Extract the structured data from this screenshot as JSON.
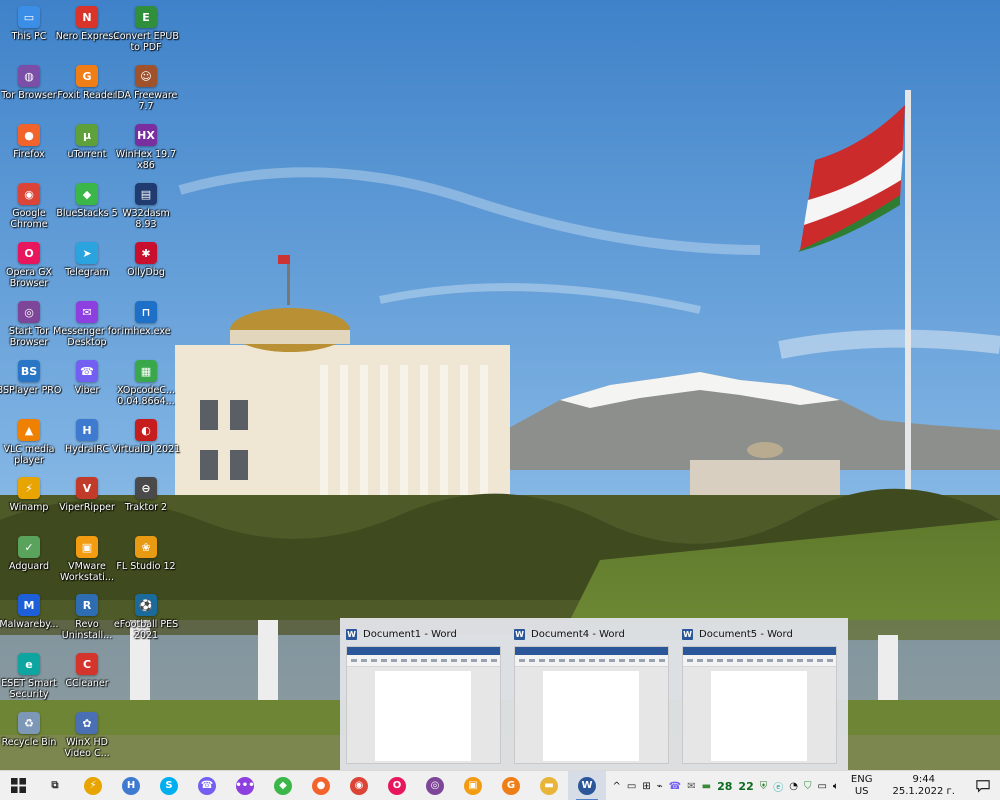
{
  "desktop": {
    "icons": [
      {
        "label": "This PC",
        "icon": "this-pc-icon",
        "color": "#3a8ee6",
        "glyph": "▭"
      },
      {
        "label": "Tor Browser",
        "icon": "tor-browser-icon",
        "color": "#7b4fa8",
        "glyph": "◍"
      },
      {
        "label": "Firefox",
        "icon": "firefox-icon",
        "color": "#f2642c",
        "glyph": "●"
      },
      {
        "label": "Google Chrome",
        "icon": "chrome-icon",
        "color": "#db4437",
        "glyph": "◉"
      },
      {
        "label": "Opera GX Browser",
        "icon": "opera-gx-icon",
        "color": "#e8175d",
        "glyph": "O"
      },
      {
        "label": "Start Tor Browser",
        "icon": "start-tor-icon",
        "color": "#7d4698",
        "glyph": "◎"
      },
      {
        "label": "BSPlayer PRO",
        "icon": "bsplayer-icon",
        "color": "#2a76c6",
        "glyph": "BS"
      },
      {
        "label": "VLC media player",
        "icon": "vlc-icon",
        "color": "#f08000",
        "glyph": "▲"
      },
      {
        "label": "Winamp",
        "icon": "winamp-icon",
        "color": "#e8a400",
        "glyph": "⚡"
      },
      {
        "label": "Adguard",
        "icon": "adguard-icon",
        "color": "#5aa35d",
        "glyph": "✓"
      },
      {
        "label": "Malwareby...",
        "icon": "malwarebytes-icon",
        "color": "#1d5fd8",
        "glyph": "M"
      },
      {
        "label": "ESET Smart Security",
        "icon": "eset-icon",
        "color": "#0ea5a0",
        "glyph": "e"
      },
      {
        "label": "Recycle Bin",
        "icon": "recycle-bin-icon",
        "color": "#7d98b6",
        "glyph": "♻"
      },
      {
        "label": "Nero Express",
        "icon": "nero-express-icon",
        "color": "#d8342a",
        "glyph": "N"
      },
      {
        "label": "Foxit Reader",
        "icon": "foxit-reader-icon",
        "color": "#f07e16",
        "glyph": "G"
      },
      {
        "label": "uTorrent",
        "icon": "utorrent-icon",
        "color": "#5ea03a",
        "glyph": "µ"
      },
      {
        "label": "BlueStacks 5",
        "icon": "bluestacks-icon",
        "color": "#3bb649",
        "glyph": "◆"
      },
      {
        "label": "Telegram",
        "icon": "telegram-icon",
        "color": "#2aa3de",
        "glyph": "➤"
      },
      {
        "label": "Messenger for Desktop",
        "icon": "messenger-icon",
        "color": "#8d3fe0",
        "glyph": "✉"
      },
      {
        "label": "Viber",
        "icon": "viber-icon",
        "color": "#7360f2",
        "glyph": "☎"
      },
      {
        "label": "HydraIRC",
        "icon": "hydrairc-icon",
        "color": "#3e7bd0",
        "glyph": "H"
      },
      {
        "label": "ViperRipper",
        "icon": "viperripper-icon",
        "color": "#c23a2a",
        "glyph": "V"
      },
      {
        "label": "VMware Workstati...",
        "icon": "vmware-icon",
        "color": "#f39c12",
        "glyph": "▣"
      },
      {
        "label": "Revo Uninstall...",
        "icon": "revo-uninstaller-icon",
        "color": "#2f6db3",
        "glyph": "R"
      },
      {
        "label": "CCleaner",
        "icon": "ccleaner-icon",
        "color": "#d3352d",
        "glyph": "C"
      },
      {
        "label": "WinX HD Video C...",
        "icon": "winx-hd-icon",
        "color": "#4a6fb5",
        "glyph": "✿"
      },
      {
        "label": "Convert EPUB to PDF",
        "icon": "convert-epub-icon",
        "color": "#2f8f3b",
        "glyph": "E"
      },
      {
        "label": "IDA Freeware 7.7",
        "icon": "ida-freeware-icon",
        "color": "#a0522d",
        "glyph": "☺"
      },
      {
        "label": "WinHex 19.7 x86",
        "icon": "winhex-icon",
        "color": "#7a2fa0",
        "glyph": "HX"
      },
      {
        "label": "W32dasm 8.93",
        "icon": "w32dasm-icon",
        "color": "#1f3b70",
        "glyph": "▤"
      },
      {
        "label": "OllyDbg",
        "icon": "ollydbg-icon",
        "color": "#c8102e",
        "glyph": "✱"
      },
      {
        "label": "imhex.exe",
        "icon": "imhex-icon",
        "color": "#1e6fc8",
        "glyph": "⊓"
      },
      {
        "label": "XOpcodeC... 0.04.8664...",
        "icon": "xopcodecalc-icon",
        "color": "#39a84a",
        "glyph": "▦"
      },
      {
        "label": "VirtualDJ 2021",
        "icon": "virtualdj-icon",
        "color": "#c61e1e",
        "glyph": "◐"
      },
      {
        "label": "Traktor 2",
        "icon": "traktor-icon",
        "color": "#4a4a4a",
        "glyph": "⊖"
      },
      {
        "label": "FL Studio 12",
        "icon": "fl-studio-icon",
        "color": "#e89a12",
        "glyph": "❀"
      },
      {
        "label": "eFootball PES 2021",
        "icon": "efootball-pes-icon",
        "color": "#1b6a9c",
        "glyph": "⚽"
      }
    ]
  },
  "taskview": {
    "windows": [
      {
        "title": "Document1 - Word",
        "app_icon": "W"
      },
      {
        "title": "Document4 - Word",
        "app_icon": "W"
      },
      {
        "title": "Document5 - Word",
        "app_icon": "W"
      }
    ]
  },
  "taskbar": {
    "pinned": [
      {
        "name": "task-view-button",
        "glyph": "⧉",
        "color": "#333333"
      },
      {
        "name": "winamp-pinned",
        "glyph": "⚡",
        "color": "#e8a400"
      },
      {
        "name": "hydrairc-pinned",
        "glyph": "H",
        "color": "#3e7bd0"
      },
      {
        "name": "skype-pinned",
        "glyph": "S",
        "color": "#00aff0"
      },
      {
        "name": "viber-pinned",
        "glyph": "☎",
        "color": "#7360f2"
      },
      {
        "name": "messenger-pinned",
        "glyph": "•••",
        "color": "#8d3fe0"
      },
      {
        "name": "bluestacks-pinned",
        "glyph": "◆",
        "color": "#3bb649"
      },
      {
        "name": "firefox-pinned",
        "glyph": "●",
        "color": "#f2642c"
      },
      {
        "name": "chrome-pinned",
        "glyph": "◉",
        "color": "#db4437"
      },
      {
        "name": "opera-pinned",
        "glyph": "O",
        "color": "#e8175d"
      },
      {
        "name": "tor-pinned",
        "glyph": "◎",
        "color": "#7d4698"
      },
      {
        "name": "vmware-pinned",
        "glyph": "▣",
        "color": "#f39c12"
      },
      {
        "name": "foxit-pinned",
        "glyph": "G",
        "color": "#f07e16"
      },
      {
        "name": "file-explorer-pinned",
        "glyph": "▬",
        "color": "#e8b53a"
      },
      {
        "name": "word-pinned",
        "glyph": "W",
        "color": "#2b579a"
      }
    ],
    "tray": {
      "chevron": "^",
      "counter_a": "28",
      "counter_b": "22",
      "lang_top": "ENG",
      "lang_bottom": "US",
      "time": "9:44",
      "date": "25.1.2022 г."
    }
  }
}
